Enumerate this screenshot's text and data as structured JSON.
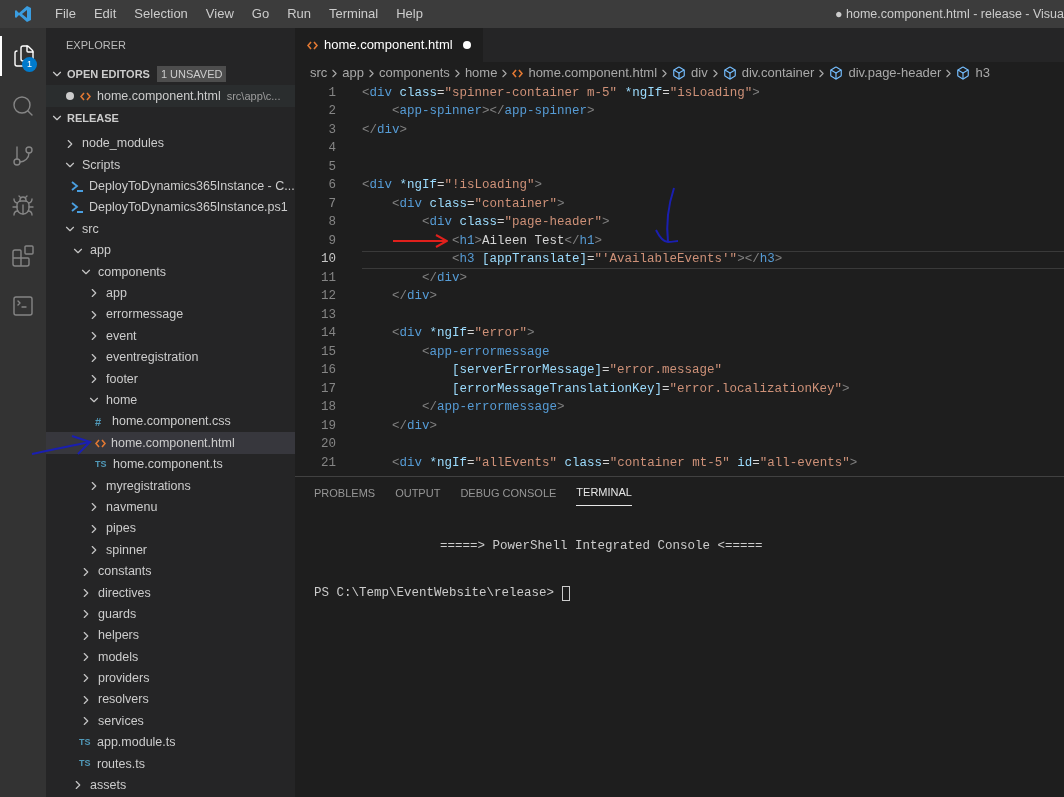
{
  "window": {
    "title": "● home.component.html - release - Visua",
    "menu": [
      "File",
      "Edit",
      "Selection",
      "View",
      "Go",
      "Run",
      "Terminal",
      "Help"
    ]
  },
  "activity_bar": [
    {
      "kind": "explorer",
      "selected": true,
      "badge": "1"
    },
    {
      "kind": "search",
      "selected": false
    },
    {
      "kind": "source-control",
      "selected": false
    },
    {
      "kind": "debug",
      "selected": false
    },
    {
      "kind": "extensions",
      "selected": false
    },
    {
      "kind": "powershell",
      "selected": false
    }
  ],
  "sidebar": {
    "title": "EXPLORER",
    "open_editors": {
      "label": "OPEN EDITORS",
      "badge": "1 UNSAVED",
      "expanded": true,
      "items": [
        {
          "name": "home.component.html",
          "path": "src\\app\\c...",
          "kind": "html",
          "modified": true
        }
      ]
    },
    "folder": {
      "label": "RELEASE",
      "expanded": true,
      "items": [
        {
          "name": "node_modules",
          "kind": "folder",
          "expanded": false,
          "selected": false
        },
        {
          "name": "Scripts",
          "kind": "folder",
          "expanded": true,
          "selected": false,
          "children": [
            {
              "name": "DeployToDynamics365Instance - C...",
              "kind": "ps",
              "selected": false
            },
            {
              "name": "DeployToDynamics365Instance.ps1",
              "kind": "ps",
              "selected": false
            }
          ]
        },
        {
          "name": "src",
          "kind": "folder",
          "expanded": true,
          "selected": false,
          "children": [
            {
              "name": "app",
              "kind": "folder",
              "expanded": true,
              "selected": false,
              "children": [
                {
                  "name": "components",
                  "kind": "folder",
                  "expanded": true,
                  "selected": false,
                  "children": [
                    {
                      "name": "app",
                      "kind": "folder",
                      "expanded": false,
                      "selected": false
                    },
                    {
                      "name": "errormessage",
                      "kind": "folder",
                      "expanded": false,
                      "selected": false
                    },
                    {
                      "name": "event",
                      "kind": "folder",
                      "expanded": false,
                      "selected": false
                    },
                    {
                      "name": "eventregistration",
                      "kind": "folder",
                      "expanded": false,
                      "selected": false
                    },
                    {
                      "name": "footer",
                      "kind": "folder",
                      "expanded": false,
                      "selected": false
                    },
                    {
                      "name": "home",
                      "kind": "folder",
                      "expanded": true,
                      "selected": false,
                      "children": [
                        {
                          "name": "home.component.css",
                          "kind": "css",
                          "icon_text": "#",
                          "selected": false
                        },
                        {
                          "name": "home.component.html",
                          "kind": "html",
                          "selected": true
                        },
                        {
                          "name": "home.component.ts",
                          "kind": "ts",
                          "icon_text": "TS",
                          "selected": false
                        }
                      ]
                    },
                    {
                      "name": "myregistrations",
                      "kind": "folder",
                      "expanded": false,
                      "selected": false
                    },
                    {
                      "name": "navmenu",
                      "kind": "folder",
                      "expanded": false,
                      "selected": false
                    },
                    {
                      "name": "pipes",
                      "kind": "folder",
                      "expanded": false,
                      "selected": false
                    },
                    {
                      "name": "spinner",
                      "kind": "folder",
                      "expanded": false,
                      "selected": false
                    }
                  ]
                },
                {
                  "name": "constants",
                  "kind": "folder",
                  "expanded": false,
                  "selected": false
                },
                {
                  "name": "directives",
                  "kind": "folder",
                  "expanded": false,
                  "selected": false
                },
                {
                  "name": "guards",
                  "kind": "folder",
                  "expanded": false,
                  "selected": false
                },
                {
                  "name": "helpers",
                  "kind": "folder",
                  "expanded": false,
                  "selected": false
                },
                {
                  "name": "models",
                  "kind": "folder",
                  "expanded": false,
                  "selected": false
                },
                {
                  "name": "providers",
                  "kind": "folder",
                  "expanded": false,
                  "selected": false
                },
                {
                  "name": "resolvers",
                  "kind": "folder",
                  "expanded": false,
                  "selected": false
                },
                {
                  "name": "services",
                  "kind": "folder",
                  "expanded": false,
                  "selected": false
                },
                {
                  "name": "app.module.ts",
                  "kind": "ts",
                  "icon_text": "TS",
                  "selected": false
                },
                {
                  "name": "routes.ts",
                  "kind": "ts",
                  "icon_text": "TS",
                  "selected": false
                }
              ]
            },
            {
              "name": "assets",
              "kind": "folder",
              "expanded": false,
              "selected": false
            }
          ]
        }
      ]
    }
  },
  "editor": {
    "tabs": [
      {
        "label": "home.component.html",
        "kind": "html",
        "modified": true,
        "selected": true
      }
    ],
    "breadcrumbs": [
      {
        "label": "src",
        "kind": "folder"
      },
      {
        "label": "app",
        "kind": "folder"
      },
      {
        "label": "components",
        "kind": "folder"
      },
      {
        "label": "home",
        "kind": "folder"
      },
      {
        "label": "home.component.html",
        "kind": "html"
      },
      {
        "label": "div",
        "kind": "symbol"
      },
      {
        "label": "div.container",
        "kind": "symbol"
      },
      {
        "label": "div.page-header",
        "kind": "symbol"
      },
      {
        "label": "h3",
        "kind": "symbol"
      }
    ],
    "lines": [
      {
        "number": "1",
        "current": false,
        "text": "<div class=\"spinner-container m-5\" *ngIf=\"isLoading\">"
      },
      {
        "number": "2",
        "current": false,
        "text": "    <app-spinner></app-spinner>"
      },
      {
        "number": "3",
        "current": false,
        "text": "</div>"
      },
      {
        "number": "4",
        "current": false
      },
      {
        "number": "5",
        "current": false
      },
      {
        "number": "6",
        "current": false,
        "text": "<div *ngIf=\"!isLoading\">"
      },
      {
        "number": "7",
        "current": false,
        "text": "    <div class=\"container\">"
      },
      {
        "number": "8",
        "current": false,
        "text": "        <div class=\"page-header\">"
      },
      {
        "number": "9",
        "current": false,
        "text": "            <h1>Aileen Test</h1>"
      },
      {
        "number": "10",
        "current": true,
        "text": "            <h3 [appTranslate]=\"'AvailableEvents'\"></h3>"
      },
      {
        "number": "11",
        "current": false,
        "text": "        </div>"
      },
      {
        "number": "12",
        "current": false,
        "text": "    </div>"
      },
      {
        "number": "13",
        "current": false
      },
      {
        "number": "14",
        "current": false,
        "text": "    <div *ngIf=\"error\">"
      },
      {
        "number": "15",
        "current": false,
        "text": "        <app-errormessage"
      },
      {
        "number": "16",
        "current": false,
        "text": "            [serverErrorMessage]=\"error.message\""
      },
      {
        "number": "17",
        "current": false,
        "text": "            [errorMessageTranslationKey]=\"error.localizationKey\">"
      },
      {
        "number": "18",
        "current": false,
        "text": "        </app-errormessage>"
      },
      {
        "number": "19",
        "current": false,
        "text": "    </div>"
      },
      {
        "number": "20",
        "current": false
      },
      {
        "number": "21",
        "current": false,
        "text": "    <div *ngIf=\"allEvents\" class=\"container mt-5\" id=\"all-events\">"
      }
    ]
  },
  "panel": {
    "tabs": [
      {
        "label": "PROBLEMS",
        "selected": false
      },
      {
        "label": "OUTPUT",
        "selected": false
      },
      {
        "label": "DEBUG CONSOLE",
        "selected": false
      },
      {
        "label": "TERMINAL",
        "selected": true
      }
    ],
    "terminal": {
      "banner": "=====> PowerShell Integrated Console <=====",
      "prompt": "PS C:\\Temp\\EventWebsite\\release>"
    }
  }
}
